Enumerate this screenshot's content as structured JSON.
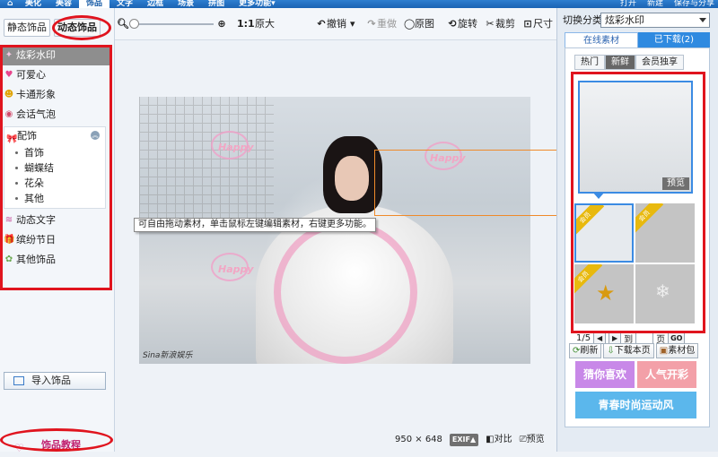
{
  "topnav": {
    "tabs": [
      {
        "label": "美化"
      },
      {
        "label": "美容"
      },
      {
        "label": "饰品",
        "active": true
      },
      {
        "label": "文字"
      },
      {
        "label": "边框"
      },
      {
        "label": "场景"
      },
      {
        "label": "拼图"
      },
      {
        "label": "更多功能▾"
      }
    ],
    "open": "打开",
    "new": "新建",
    "save": "保存与分享"
  },
  "left": {
    "static_tab": "静态饰品",
    "dynamic_tab": "动态饰品",
    "categories": [
      {
        "label": "炫彩水印",
        "icon": "✦"
      },
      {
        "label": "可爱心",
        "icon": "♥"
      },
      {
        "label": "卡通形象",
        "icon": "☻"
      },
      {
        "label": "会话气泡",
        "icon": "◉"
      }
    ],
    "accessory": {
      "label": "配饰",
      "icon": "🎀",
      "items": [
        "首饰",
        "蝴蝶结",
        "花朵",
        "其他"
      ]
    },
    "categories2": [
      {
        "label": "动态文字",
        "icon": "≋"
      },
      {
        "label": "缤纷节日",
        "icon": "🎁"
      },
      {
        "label": "其他饰品",
        "icon": "✿"
      }
    ],
    "import_label": "导入饰品",
    "tutorial_label": "饰品教程"
  },
  "toolbar": {
    "zoom_ratio": "1:1",
    "original_size": "原大",
    "undo": "撤销",
    "redo": "重做",
    "original": "原图",
    "rotate": "旋转",
    "crop": "裁剪",
    "size": "尺寸"
  },
  "canvas": {
    "tooltip": "可自由拖动素材，单击鼠标左键编辑素材，右键更多功能。",
    "happy_text": "Happy",
    "watermark": "Sina新浪娱乐"
  },
  "status": {
    "dimensions": "950 × 648",
    "exif": "EXIF▲",
    "compare": "对比",
    "preview": "预览"
  },
  "right": {
    "switch_label": "切换分类",
    "switch_value": "炫彩水印",
    "tabs": [
      "在线素材",
      "已下载(2)"
    ],
    "subtabs": [
      "热门",
      "新鲜",
      "会员独享"
    ],
    "preview_label": "预览",
    "member_badge": "会员",
    "pager": {
      "page": "1/5",
      "goto": "到",
      "unit": "页",
      "go": "GO"
    },
    "actions": [
      "刷新",
      "下载本页",
      "素材包"
    ],
    "promos": [
      "猜你喜欢",
      "人气开彩",
      "青春时尚运动风"
    ]
  }
}
